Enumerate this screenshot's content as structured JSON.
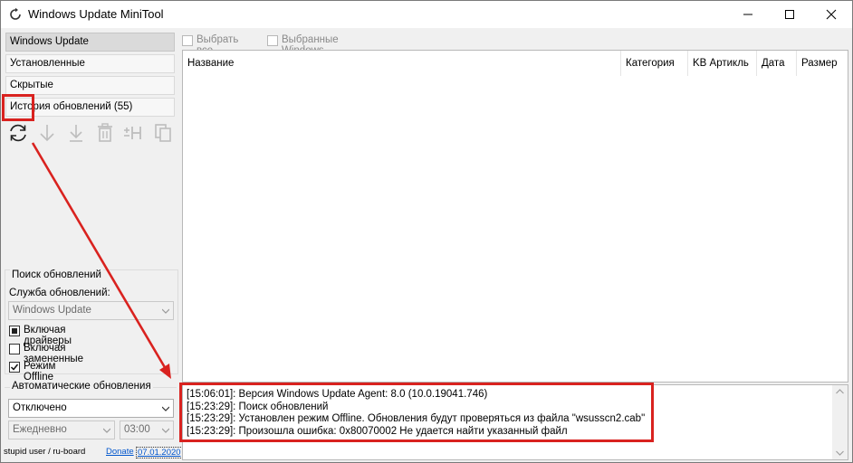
{
  "window": {
    "title": "Windows Update MiniTool",
    "icon": "refresh-icon"
  },
  "nav": {
    "items": [
      {
        "label": "Windows Update",
        "active": true
      },
      {
        "label": "Установленные",
        "active": false
      },
      {
        "label": "Скрытые",
        "active": false
      },
      {
        "label": "История обновлений (55)",
        "active": false
      }
    ]
  },
  "toolbar": {
    "icons": [
      "refresh-icon",
      "download-arrow-icon",
      "install-arrow-icon",
      "trash-icon",
      "hide-icon",
      "copy-icon"
    ]
  },
  "search_group": {
    "title": "Поиск обновлений",
    "service_label": "Служба обновлений:",
    "service_value": "Windows Update",
    "include_drivers": {
      "label": "Включая драйверы",
      "state": "indeterminate"
    },
    "include_superseded": {
      "label": "Включая замененные",
      "state": "unchecked"
    },
    "offline_mode": {
      "label": "Режим Offline",
      "state": "checked"
    }
  },
  "auto_group": {
    "title": "Автоматические обновления",
    "mode_value": "Отключено",
    "schedule_value": "Ежедневно",
    "time_value": "03:00"
  },
  "status": {
    "user": "stupid user / ru-board",
    "donate": "Donate",
    "date": "07.01.2020"
  },
  "top_checks": {
    "select_all": "Выбрать все",
    "selected_updates": "Выбранные Windows Update"
  },
  "list": {
    "columns": [
      "Название",
      "Категория",
      "KB Артикль",
      "Дата",
      "Размер"
    ]
  },
  "log": {
    "lines": [
      "[15:06:01]: Версия Windows Update Agent: 8.0 (10.0.19041.746)",
      "[15:23:29]: Поиск обновлений",
      "[15:23:29]: Установлен режим Offline. Обновления будут проверяться из файла \"wsusscn2.cab\"",
      "[15:23:29]: Произошла ошибка: 0x80070002 Не удается найти указанный файл"
    ]
  },
  "colors": {
    "annotation_red": "#d9221f",
    "link_blue": "#0055cc",
    "window_bg": "#f0f0f0"
  }
}
